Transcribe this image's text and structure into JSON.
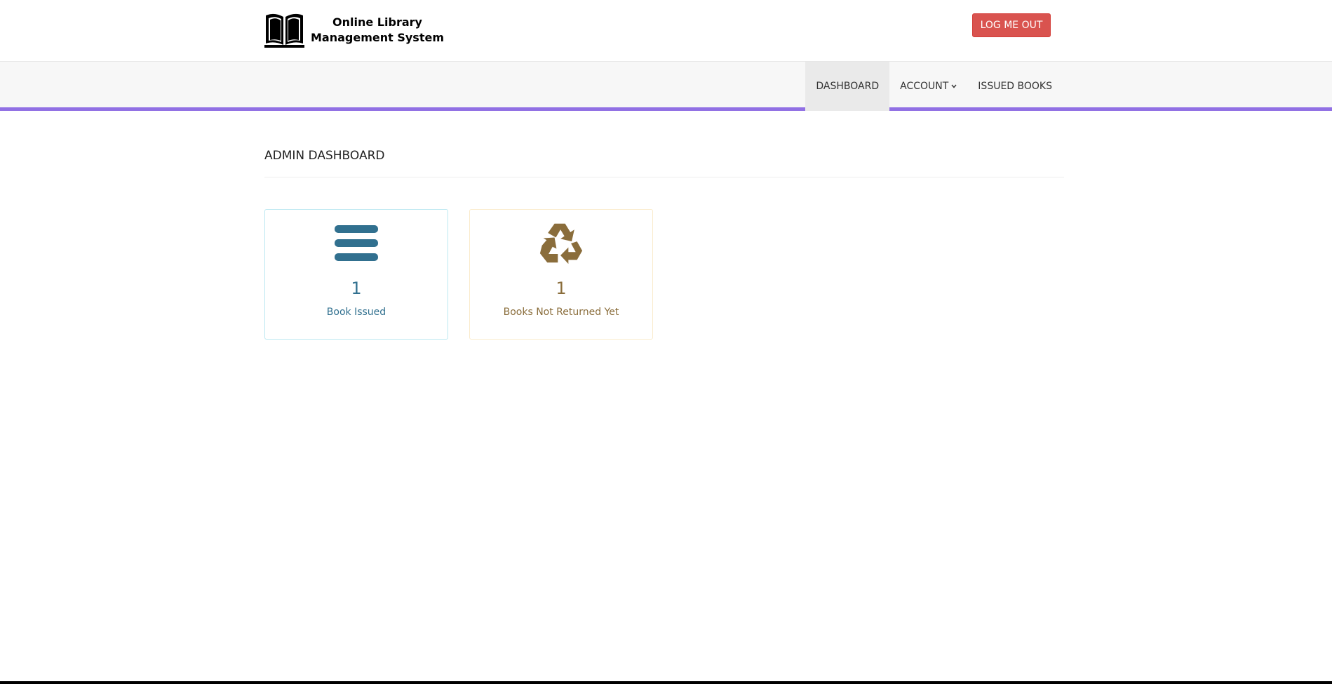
{
  "header": {
    "site_title_line1": "Online Library",
    "site_title_line2": "Management System",
    "logo_icon": "open-book-icon",
    "logout_label": "LOG ME OUT"
  },
  "nav": {
    "items": [
      {
        "label": "DASHBOARD",
        "active": true
      },
      {
        "label": "ACCOUNT",
        "dropdown": true
      },
      {
        "label": "ISSUED BOOKS"
      }
    ]
  },
  "main": {
    "title": "ADMIN DASHBOARD",
    "cards": [
      {
        "icon": "bars-icon",
        "count": "1",
        "label": "Book Issued",
        "color": "#31708f"
      },
      {
        "icon": "recycle-icon",
        "count": "1",
        "label": "Books Not Returned Yet",
        "color": "#8a6d3b"
      }
    ]
  },
  "colors": {
    "accent": "#9170e4",
    "logout": "#d9534f"
  }
}
